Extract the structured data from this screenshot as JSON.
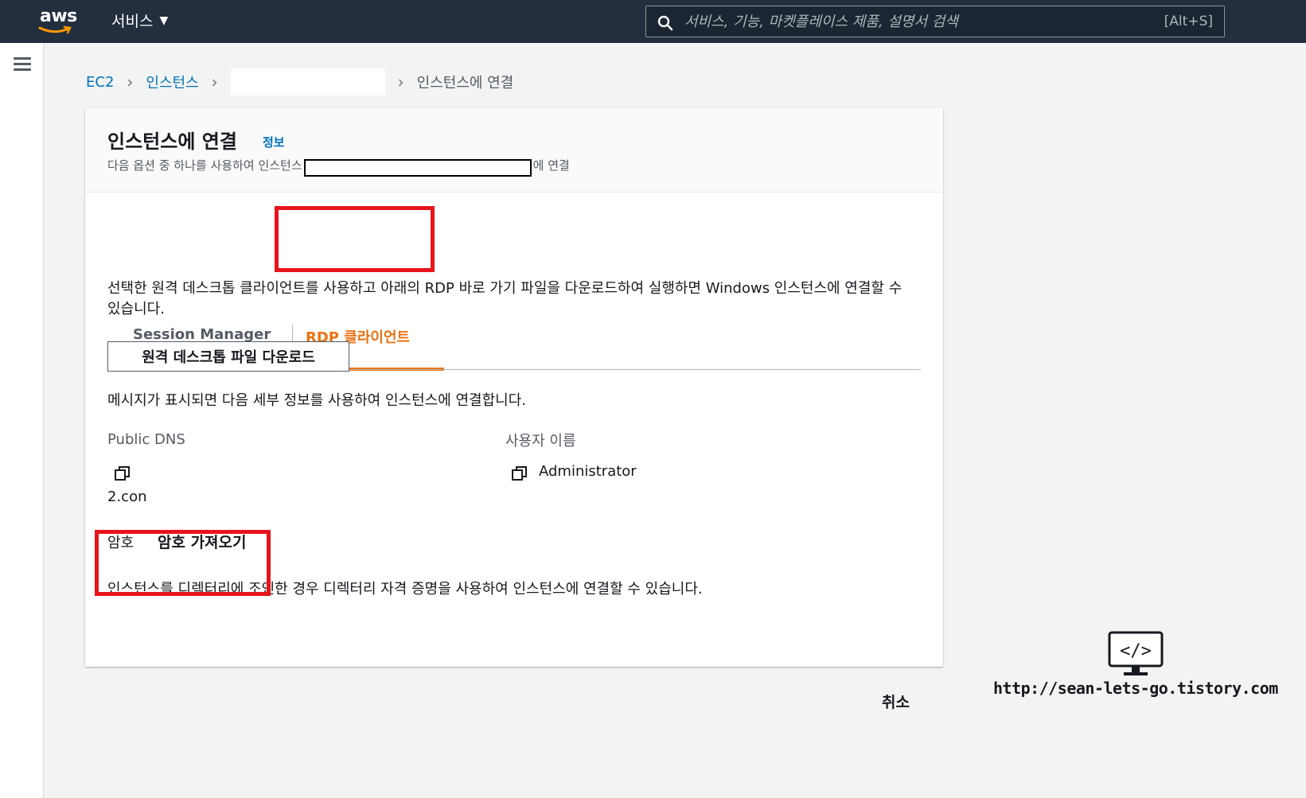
{
  "topnav": {
    "logo_text": "aws",
    "services_label": "서비스",
    "search_placeholder": "서비스, 기능, 마켓플레이스 제품, 설명서 검색",
    "search_shortcut": "[Alt+S]"
  },
  "breadcrumb": {
    "ec2": "EC2",
    "instances": "인스턴스",
    "current": "인스턴스에 연결"
  },
  "header": {
    "title": "인스턴스에 연결",
    "info_link": "정보",
    "subtitle_prefix": "다음 옵션 중 하나를 사용하여 인스턴스",
    "subtitle_suffix": "에 연결"
  },
  "tabs": {
    "session_manager": "Session Manager",
    "rdp_client": "RDP 클라이언트"
  },
  "rdp": {
    "description": "선택한 원격 데스크톱 클라이언트를 사용하고 아래의 RDP 바로 가기 파일을 다운로드하여 실행하면 Windows 인스턴스에 연결할 수 있습니다.",
    "download_button": "원격 데스크톱 파일 다운로드",
    "prompt_text": "메시지가 표시되면 다음 세부 정보를 사용하여 인스턴스에 연결합니다.",
    "public_dns_label": "Public DNS",
    "public_dns_value": "2.con",
    "username_label": "사용자 이름",
    "username_value": "Administrator",
    "password_label": "암호",
    "get_password_link": "암호 가져오기",
    "directory_text": "인스턴스를 디렉터리에 조인한 경우 디렉터리 자격 증명을 사용하여 인스턴스에 연결할 수 있습니다."
  },
  "footer": {
    "cancel_label": "취소"
  },
  "watermark": {
    "url": "http://sean-lets-go.tistory.com"
  },
  "colors": {
    "nav_bg": "#232f3e",
    "link": "#0073bb",
    "accent_orange": "#ec7211",
    "highlight_red": "#e8141c"
  }
}
